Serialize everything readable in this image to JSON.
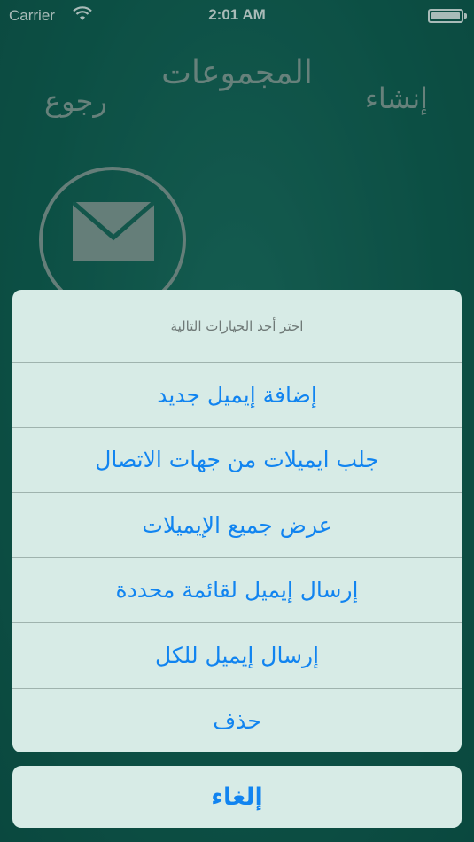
{
  "status_bar": {
    "carrier": "Carrier",
    "time": "2:01 AM"
  },
  "nav": {
    "title": "المجموعات",
    "back_label": "رجوع",
    "create_label": "إنشاء"
  },
  "icons": {
    "wifi": "wifi-icon",
    "battery": "battery-icon",
    "mail": "envelope-icon"
  },
  "action_sheet": {
    "title": "اختر أحد الخيارات التالية",
    "options": [
      "إضافة إيميل جديد",
      "جلب ايميلات من جهات الاتصال",
      "عرض جميع الإيميلات",
      "إرسال إيميل لقائمة محددة",
      "إرسال إيميل للكل",
      "حذف"
    ],
    "cancel_label": "إلغاء"
  },
  "colors": {
    "background": "#0f5a4e",
    "sheet": "#d7ebe6",
    "accent": "#1184f0"
  }
}
